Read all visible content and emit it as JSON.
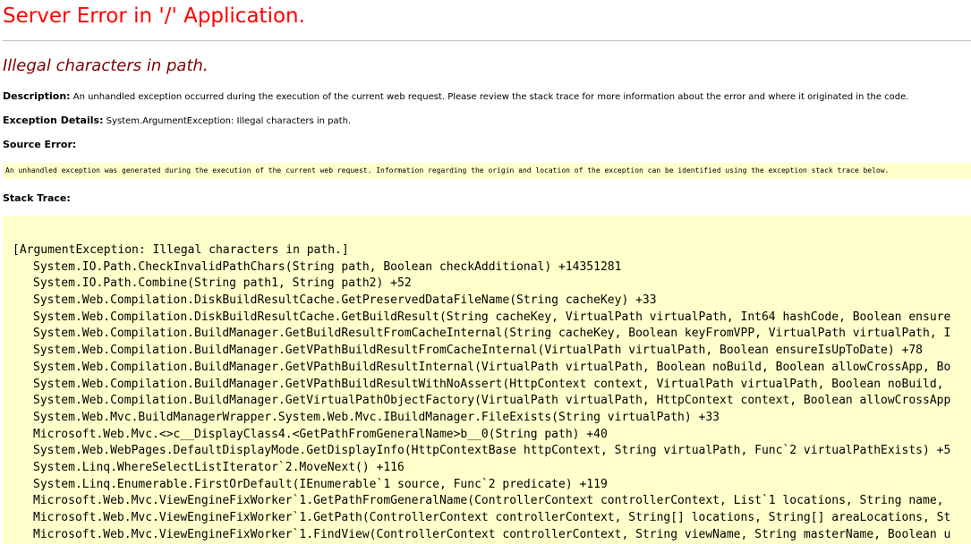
{
  "page": {
    "title": "Server Error in '/' Application.",
    "error_message": "Illegal characters in path.",
    "description": {
      "label": "Description:",
      "text": "An unhandled exception occurred during the execution of the current web request. Please review the stack trace for more information about the error and where it originated in the code."
    },
    "exception_details": {
      "label": "Exception Details:",
      "text": "System.ArgumentException: Illegal characters in path."
    },
    "source_error": {
      "label": "Source Error:",
      "text": "An unhandled exception was generated during the execution of the current web request. Information regarding the origin and location of the exception can be identified using the exception stack trace below."
    },
    "stack_trace": {
      "label": "Stack Trace:",
      "lines": [
        "[ArgumentException: Illegal characters in path.]",
        "System.IO.Path.CheckInvalidPathChars(String path, Boolean checkAdditional) +14351281",
        "System.IO.Path.Combine(String path1, String path2) +52",
        "System.Web.Compilation.DiskBuildResultCache.GetPreservedDataFileName(String cacheKey) +33",
        "System.Web.Compilation.DiskBuildResultCache.GetBuildResult(String cacheKey, VirtualPath virtualPath, Int64 hashCode, Boolean ensure",
        "System.Web.Compilation.BuildManager.GetBuildResultFromCacheInternal(String cacheKey, Boolean keyFromVPP, VirtualPath virtualPath, I",
        "System.Web.Compilation.BuildManager.GetVPathBuildResultFromCacheInternal(VirtualPath virtualPath, Boolean ensureIsUpToDate) +78",
        "System.Web.Compilation.BuildManager.GetVPathBuildResultInternal(VirtualPath virtualPath, Boolean noBuild, Boolean allowCrossApp, Bo",
        "System.Web.Compilation.BuildManager.GetVPathBuildResultWithNoAssert(HttpContext context, VirtualPath virtualPath, Boolean noBuild, ",
        "System.Web.Compilation.BuildManager.GetVirtualPathObjectFactory(VirtualPath virtualPath, HttpContext context, Boolean allowCrossApp",
        "System.Web.Mvc.BuildManagerWrapper.System.Web.Mvc.IBuildManager.FileExists(String virtualPath) +33",
        "Microsoft.Web.Mvc.<>c__DisplayClass4.<GetPathFromGeneralName>b__0(String path) +40",
        "System.Web.WebPages.DefaultDisplayMode.GetDisplayInfo(HttpContextBase httpContext, String virtualPath, Func`2 virtualPathExists) +5",
        "System.Linq.WhereSelectListIterator`2.MoveNext() +116",
        "System.Linq.Enumerable.FirstOrDefault(IEnumerable`1 source, Func`2 predicate) +119",
        "Microsoft.Web.Mvc.ViewEngineFixWorker`1.GetPathFromGeneralName(ControllerContext controllerContext, List`1 locations, String name, ",
        "Microsoft.Web.Mvc.ViewEngineFixWorker`1.GetPath(ControllerContext controllerContext, String[] locations, String[] areaLocations, St",
        "Microsoft.Web.Mvc.ViewEngineFixWorker`1.FindView(ControllerContext controllerContext, String viewName, String masterName, Boolean u"
      ]
    }
  },
  "colors": {
    "title": "#ff0000",
    "error_message": "#800000",
    "code_background": "#ffffcc",
    "rule": "#c0c0c0"
  }
}
